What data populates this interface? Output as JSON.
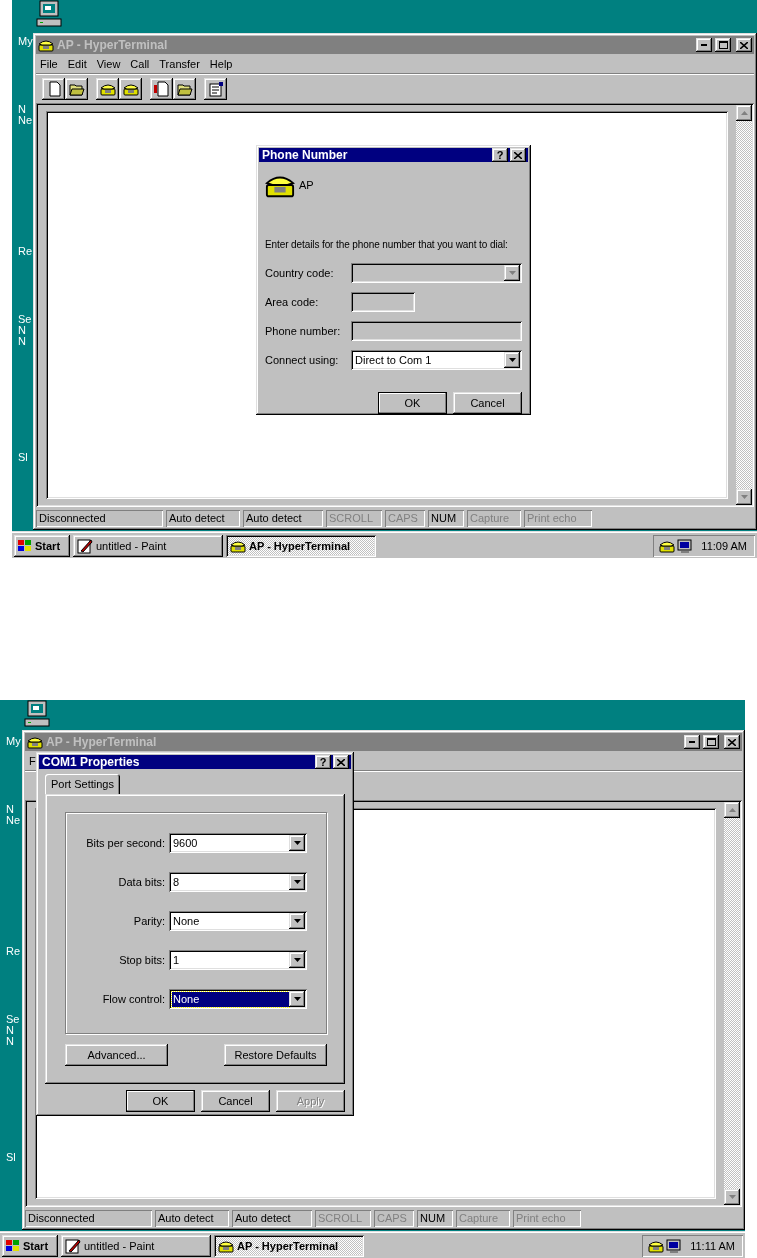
{
  "screens": [
    {
      "desktop": {
        "labels": [
          [
            "My"
          ],
          [
            "N",
            "Ne"
          ],
          [
            "Re"
          ],
          [
            "Se",
            "N",
            "N"
          ],
          [
            "Sl"
          ]
        ]
      },
      "window": {
        "title": "AP - HyperTerminal",
        "active": false,
        "menu": [
          "File",
          "Edit",
          "View",
          "Call",
          "Transfer",
          "Help"
        ],
        "toolbar": [
          [
            {
              "kind": "new"
            },
            {
              "kind": "open"
            }
          ],
          [
            {
              "kind": "call"
            },
            {
              "kind": "hangup"
            }
          ],
          [
            {
              "kind": "send"
            },
            {
              "kind": "receive"
            }
          ],
          [
            {
              "kind": "properties"
            }
          ]
        ],
        "status_bar": [
          {
            "text": "Disconnected",
            "disabled": false
          },
          {
            "text": "Auto detect",
            "disabled": false
          },
          {
            "text": "Auto detect",
            "disabled": false
          },
          {
            "text": "SCROLL",
            "disabled": true
          },
          {
            "text": "CAPS",
            "disabled": true
          },
          {
            "text": "NUM",
            "disabled": false
          },
          {
            "text": "Capture",
            "disabled": true
          },
          {
            "text": "Print echo",
            "disabled": true
          }
        ]
      },
      "dialog": {
        "kind": "phone",
        "title": "Phone Number",
        "help": "?",
        "entry": "AP",
        "prompt": "Enter details for the phone number that you want to dial:",
        "fields": [
          {
            "kind": "dropdown",
            "label": "Country code:",
            "disabled": true
          },
          {
            "kind": "short_text",
            "label": "Area code:",
            "disabled": true
          },
          {
            "kind": "text",
            "label": "Phone number:",
            "disabled": true
          },
          {
            "kind": "dropdown",
            "label": "Connect using:",
            "value": "Direct to Com 1",
            "disabled": false
          }
        ],
        "buttons": [
          {
            "label": "OK",
            "default": true,
            "disabled": false
          },
          {
            "label": "Cancel",
            "default": false,
            "disabled": false
          }
        ]
      },
      "taskbar": {
        "start": "Start",
        "tasks": [
          {
            "kind": "paint",
            "label": "untitled - Paint",
            "selected": false
          },
          {
            "kind": "terminal",
            "label": "AP - HyperTerminal",
            "selected": true
          }
        ],
        "clock": "11:09 AM"
      }
    },
    {
      "desktop": {
        "labels": [
          [
            "My"
          ],
          [
            "N",
            "Ne"
          ],
          [
            "Re"
          ],
          [
            "Se",
            "N",
            "N"
          ],
          [
            "Sl"
          ]
        ]
      },
      "window": {
        "title": "AP - HyperTerminal",
        "active": false,
        "menu": [
          "F"
        ],
        "status_bar": [
          {
            "text": "Disconnected",
            "disabled": false
          },
          {
            "text": "Auto detect",
            "disabled": false
          },
          {
            "text": "Auto detect",
            "disabled": false
          },
          {
            "text": "SCROLL",
            "disabled": true
          },
          {
            "text": "CAPS",
            "disabled": true
          },
          {
            "text": "NUM",
            "disabled": false
          },
          {
            "text": "Capture",
            "disabled": true
          },
          {
            "text": "Print echo",
            "disabled": true
          }
        ]
      },
      "dialog": {
        "kind": "port",
        "title": "COM1 Properties",
        "help": "?",
        "tabs": [
          {
            "label": "Port Settings",
            "selected": true
          }
        ],
        "fields": [
          {
            "label": "Bits per second:",
            "value": "9600",
            "focused": false
          },
          {
            "label": "Data bits:",
            "value": "8",
            "focused": false
          },
          {
            "label": "Parity:",
            "value": "None",
            "focused": false
          },
          {
            "label": "Stop bits:",
            "value": "1",
            "focused": false
          },
          {
            "label": "Flow control:",
            "value": "None",
            "focused": true
          }
        ],
        "extra_buttons": [
          {
            "label": "Advanced...",
            "default": false,
            "disabled": false
          },
          {
            "label": "Restore Defaults",
            "default": false,
            "disabled": false
          }
        ],
        "buttons": [
          {
            "label": "OK",
            "default": true,
            "disabled": false
          },
          {
            "label": "Cancel",
            "default": false,
            "disabled": false
          },
          {
            "label": "Apply",
            "default": false,
            "disabled": true
          }
        ]
      },
      "taskbar": {
        "start": "Start",
        "tasks": [
          {
            "kind": "paint",
            "label": "untitled - Paint",
            "selected": false
          },
          {
            "kind": "terminal",
            "label": "AP - HyperTerminal",
            "selected": true
          }
        ],
        "clock": "11:11 AM"
      }
    }
  ]
}
